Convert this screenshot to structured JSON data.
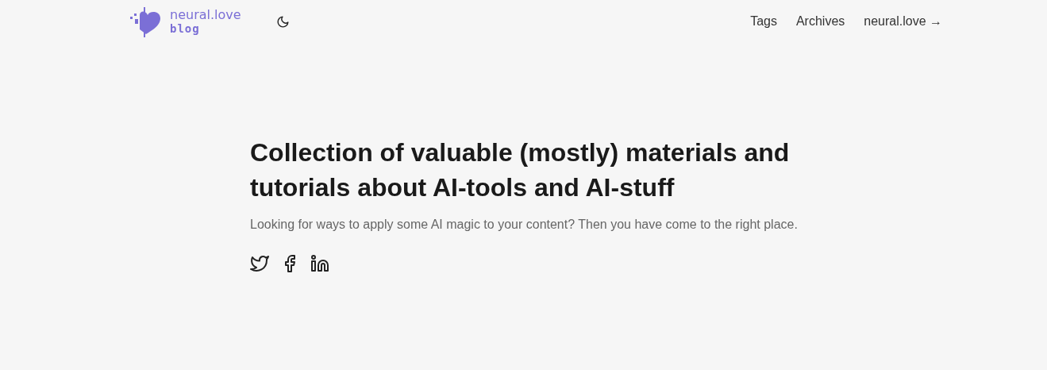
{
  "header": {
    "logo": {
      "name": "neural.love",
      "sub": "blog"
    },
    "nav": [
      {
        "label": "Tags"
      },
      {
        "label": "Archives"
      },
      {
        "label": "neural.love →"
      }
    ]
  },
  "hero": {
    "title": "Collection of valuable (mostly) materials and tutorials about AI-tools and AI-stuff",
    "subtitle": "Looking for ways to apply some AI magic to your content? Then you have come to the right place.",
    "social": [
      {
        "kind": "twitter"
      },
      {
        "kind": "facebook"
      },
      {
        "kind": "linkedin"
      }
    ]
  }
}
